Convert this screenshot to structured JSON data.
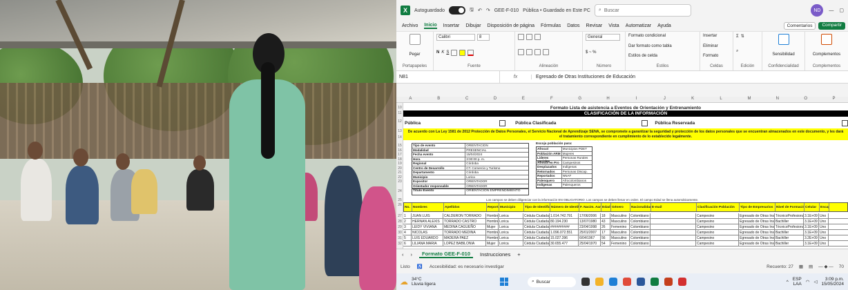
{
  "excel": {
    "autosave_label": "Autoguardado",
    "file_title": "GEE-F-010",
    "file_status": "Pública • Guardado en Este PC",
    "search_placeholder": "Buscar",
    "user_initials": "ND",
    "menu": [
      "Archivo",
      "Inicio",
      "Insertar",
      "Dibujar",
      "Disposición de página",
      "Fórmulas",
      "Datos",
      "Revisar",
      "Vista",
      "Automatizar",
      "Ayuda"
    ],
    "active_menu": "Inicio",
    "comments_label": "Comentarios",
    "share_label": "Compartir",
    "ribbon": {
      "paste": "Pegar",
      "clipboard": "Portapapeles",
      "font_name": "Calibri",
      "font_size": "8",
      "font": "Fuente",
      "alignment": "Alineación",
      "number_format": "General",
      "number": "Número",
      "cond_format": "Formato condicional",
      "table_format": "Dar formato como tabla",
      "cell_styles": "Estilos de celda",
      "styles": "Estilos",
      "insert": "Insertar",
      "delete": "Eliminar",
      "format": "Formato",
      "cells": "Celdas",
      "editing": "Edición",
      "sensitivity": "Sensibilidad",
      "confidentiality": "Confidencialidad",
      "addins": "Complementos",
      "addins_group": "Complementos"
    },
    "name_box": "N81",
    "formula_content": "Egresado de Otras Instituciones de Educación",
    "columns": [
      "A",
      "B",
      "C",
      "D",
      "E",
      "F",
      "G",
      "H",
      "I",
      "J",
      "K",
      "L",
      "M",
      "N",
      "O",
      "P"
    ],
    "row_numbers": [
      "10",
      "11",
      "12",
      "13",
      "14",
      "15",
      "16",
      "17",
      "18",
      "19",
      "20",
      "21",
      "22",
      "23",
      "24",
      "25",
      "26",
      "27",
      "28",
      "29",
      "30",
      "31",
      "32"
    ],
    "sheet": {
      "title": "Formato Lista de asistencia a Eventos de Orientación y Entrenamiento",
      "classification": "CLASIFICACIÓN DE LA INFORMACIÓN",
      "public": "Pública",
      "public_classified": "Pública Clasificada",
      "public_reserved": "Pública Reservada",
      "legal_notice": "De acuerdo con La Ley 1581 de 2012 Protección de Datos Personales, el Servicio Nacional de Aprendizaje SENA, se compromete a garantizar la seguridad y protección de los datos personales que se encuentran almacenados en este documento, y les dará el tratamiento correspondiente en cumplimiento de lo establecido legalmente.",
      "event_info": [
        {
          "label": "Tipo de evento",
          "value": "ORIENTACION"
        },
        {
          "label": "Modalidad",
          "value": "PRESENCIAL"
        },
        {
          "label": "Fecha evento",
          "value": "15/04/2024"
        },
        {
          "label": "Hora",
          "value": "3:00:00 p. m."
        },
        {
          "label": "Regional",
          "value": "Córdoba"
        },
        {
          "label": "Centro de Desarrollo",
          "value": "CT. Comercio y Turismo"
        },
        {
          "label": "Departamento",
          "value": "Córdoba"
        },
        {
          "label": "Municipio",
          "value": "Lorica"
        },
        {
          "label": "Expositor",
          "value": "ORIENTADOR"
        },
        {
          "label": "Orientador responsable",
          "value": "ORIENTADOR"
        }
      ],
      "pop_title": "Escoja población para:",
      "population": [
        {
          "label": "Afrocol",
          "value": "Municipios PDET"
        },
        {
          "label": "Población ARM",
          "value": "Mujeres"
        },
        {
          "label": "Líderes sociales",
          "value": "Personas Rurales"
        },
        {
          "label": "Afrocol en Pro",
          "value": "Campesinos"
        },
        {
          "label": "Desplazados",
          "value": "Indígenas"
        },
        {
          "label": "Retornados",
          "value": "Personas Discap."
        },
        {
          "label": "Reportados",
          "value": "NNAF"
        },
        {
          "label": "Palenquero",
          "value": "Afrocolombianos"
        },
        {
          "label": "Indígenas",
          "value": "Palenqueros"
        }
      ],
      "event_title_label": "Título Evento",
      "event_title_value": "ORIENTACIÓN EMPRENDIMIENTO",
      "instructions": "Los campos se deben diligenciar con la información EN OBLIGATORIO. Los campos se deben llenar en orden. El campo Edad se llena automáticamente.",
      "headers": [
        "No.",
        "Nombres",
        "Apellidos",
        "Reporta sex",
        "Municipio",
        "Tipo de Identificación",
        "Número de Identificación",
        "F. Nacim. Aamaaño",
        "Edad",
        "Género",
        "Nacionalidad",
        "E-mail",
        "Clasificación Población",
        "Tipo de Empresarios",
        "Nivel de Formación",
        "Celular",
        "Escap."
      ],
      "rows": [
        {
          "no": "1",
          "nombre": "JUAN LUIS",
          "apellido": "CALDERON TORRADO",
          "sexo": "Hombre",
          "mun": "Lorica",
          "tipo": "Cédula Ciudadanía",
          "num": "1.014.742.791",
          "fecha": "17/06/2006",
          "edad": "18",
          "genero": "Masculino",
          "nac": "Colombiano",
          "clas": "Campesino",
          "emp": "Egresado de Otras Instituciones de Educación",
          "nivel": "TécnicoProfesional",
          "cel": "3.1E+09",
          "esc": "Uno"
        },
        {
          "no": "2",
          "nombre": "HERNAN ALEXIS",
          "apellido": "TORRADO CASTRO",
          "sexo": "Hombre",
          "mun": "Lorica",
          "tipo": "Cédula Ciudadanía",
          "num": "80.194.230",
          "fecha": "13/07/1980",
          "edad": "43",
          "genero": "Masculino",
          "nac": "Colombiano",
          "clas": "Campesino",
          "emp": "Egresado de Otras Instituciones de Educación",
          "nivel": "Bachiller",
          "cel": "3.1E+09",
          "esc": "Uno"
        },
        {
          "no": "3",
          "nombre": "LEIDY VIVIANA",
          "apellido": "MEDINA CAGUEÑO",
          "sexo": "Mujer",
          "mun": "Lorica",
          "tipo": "Cédula Ciudadanía",
          "num": "##########",
          "fecha": "23/04/1998",
          "edad": "26",
          "genero": "Femenino",
          "nac": "Colombiano",
          "clas": "Campesino",
          "emp": "Egresado de Otras Instituciones de Educación",
          "nivel": "TécnicoProfesional",
          "cel": "3.1E+09",
          "esc": "Uno"
        },
        {
          "no": "4",
          "nombre": "NICOLAS",
          "apellido": "TORRADO MEDINA",
          "sexo": "Hombre",
          "mun": "Lorica",
          "tipo": "Cédula Ciudadanía",
          "num": "1.096.072.551",
          "fecha": "25/01/2007",
          "edad": "17",
          "genero": "Masculino",
          "nac": "Colombiano",
          "clas": "Campesino",
          "emp": "Egresado de Otras Instituciones de Educación",
          "nivel": "Bachiller",
          "cel": "3.1E+09",
          "esc": "Uno"
        },
        {
          "no": "5",
          "nombre": "LUIS EDUARDO",
          "apellido": "MADERA PAEZ",
          "sexo": "Hombre",
          "mun": "Lorica",
          "tipo": "Cédula Ciudadanía",
          "num": "15.027.396",
          "fecha": "6/04/1967",
          "edad": "56",
          "genero": "Masculino",
          "nac": "Colombiano",
          "clas": "Campesino",
          "emp": "Egresado de Otras Instituciones de Educación",
          "nivel": "Bachiller",
          "cel": "3.2E+09",
          "esc": "Uno"
        },
        {
          "no": "6",
          "nombre": "LILIANA MARIA",
          "apellido": "LOPEZ BABILONIA",
          "sexo": "Mujer",
          "mun": "Lorica",
          "tipo": "Cédula Ciudadanía",
          "num": "30.655.477",
          "fecha": "25/04/1970",
          "edad": "54",
          "genero": "Femenino",
          "nac": "Colombiano",
          "clas": "Campesino",
          "emp": "Egresado de Otras Instituciones de Educación",
          "nivel": "Bachiller",
          "cel": "3.1E+09",
          "esc": "Uno"
        }
      ]
    },
    "tabs": [
      "Formato GEE-F-010",
      "Instrucciones"
    ],
    "active_tab": "Formato GEE-F-010",
    "status_ready": "Listo",
    "status_accessibility": "Accesibilidad: es necesario investigar",
    "status_count": "Recuento: 27",
    "zoom": "70",
    "taskbar": {
      "temp": "34°C",
      "weather": "Lluvia ligera",
      "search": "Buscar",
      "lang": "ESP",
      "lang_sub": "LAA",
      "time": "3:09 p.m.",
      "date": "15/05/2024"
    },
    "colors": {
      "excel_green": "#107c41",
      "header_yellow": "#ffff00",
      "classification_black": "#000000"
    }
  }
}
